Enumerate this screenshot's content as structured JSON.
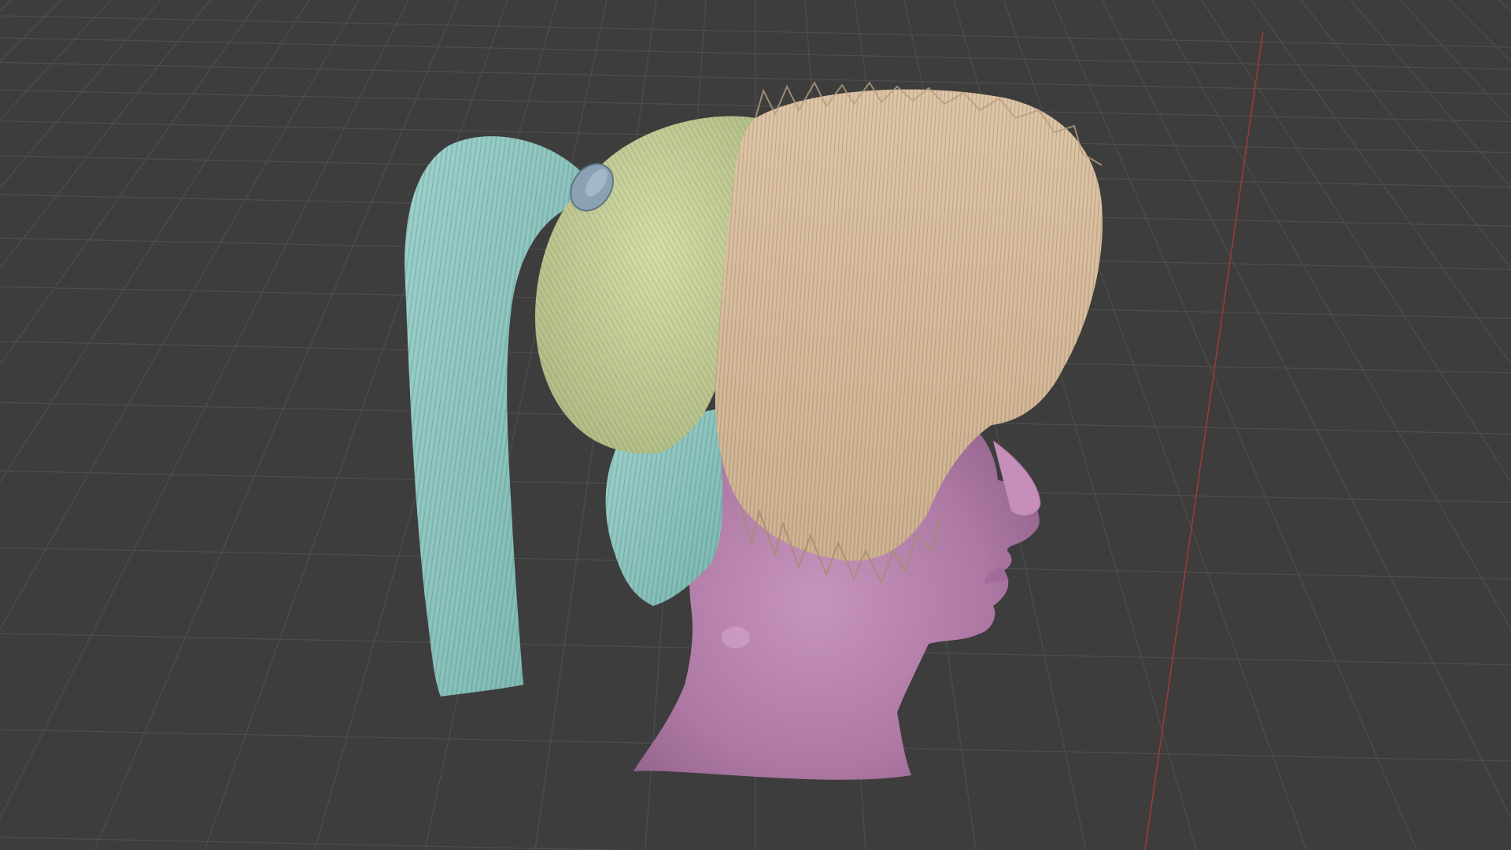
{
  "viewport": {
    "background_color": "#3d3d3d",
    "grid_color": "#4e4e4e",
    "x_axis_color": "#9a3a3a",
    "show_grid": true,
    "show_x_axis": true
  },
  "scene": {
    "objects": [
      {
        "name": "head-mesh",
        "color": "#b07aa6"
      },
      {
        "name": "hair-ponytail",
        "color": "#86c0bb"
      },
      {
        "name": "hair-scalp-back",
        "color": "#c6cf98"
      },
      {
        "name": "hair-bangs-front",
        "color": "#d6bb9b"
      },
      {
        "name": "hair-tie",
        "color": "#8aa2b4"
      }
    ]
  }
}
